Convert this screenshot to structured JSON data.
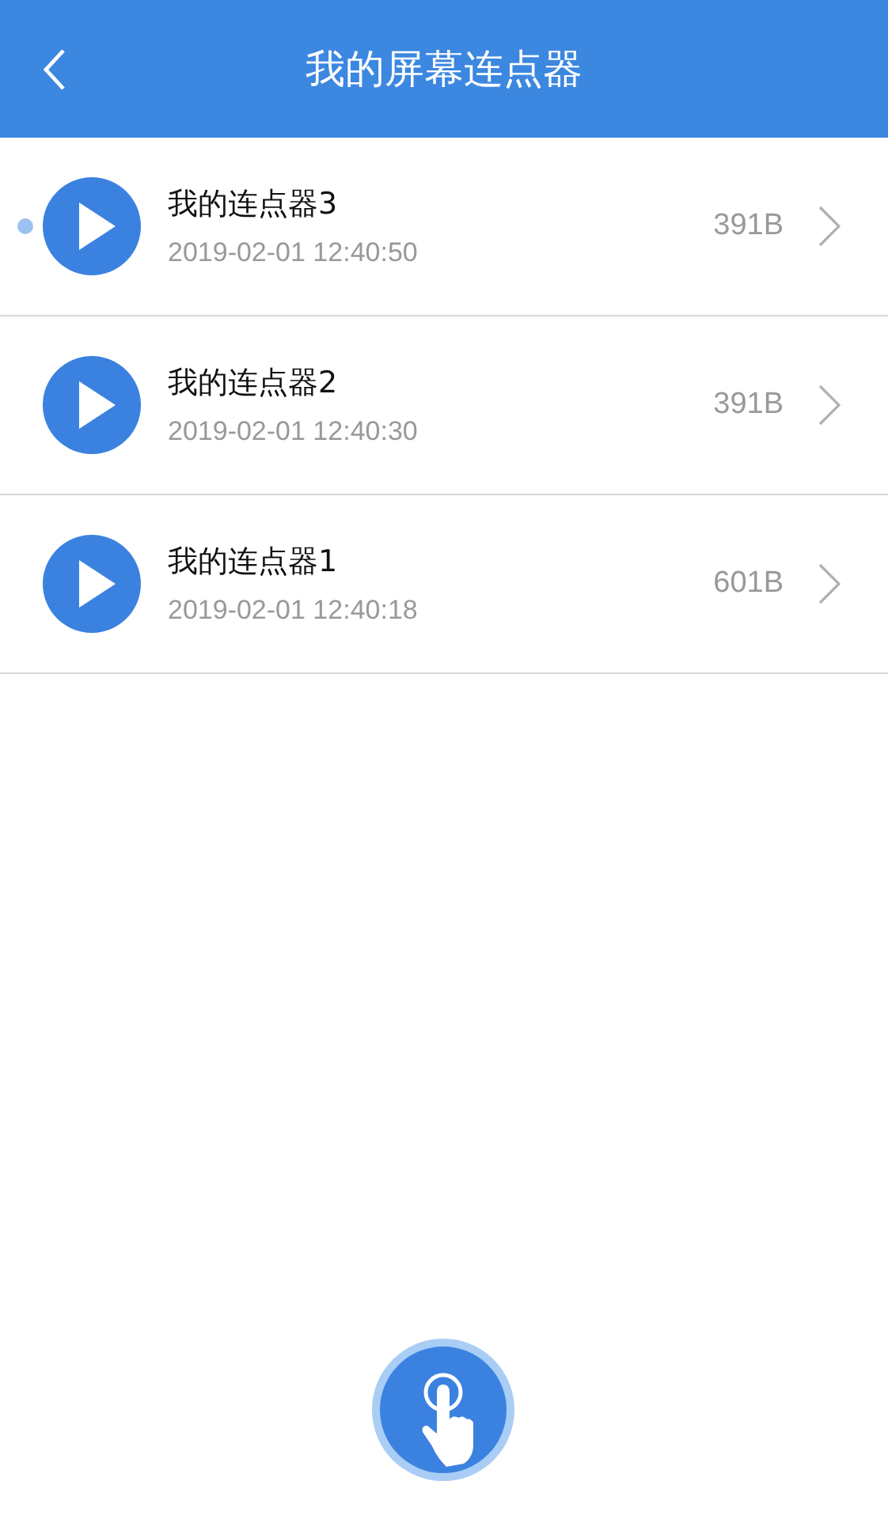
{
  "header": {
    "title": "我的屏幕连点器"
  },
  "items": [
    {
      "name": "我的连点器3",
      "time": "2019-02-01 12:40:50",
      "size": "391B",
      "marked": true
    },
    {
      "name": "我的连点器2",
      "time": "2019-02-01 12:40:30",
      "size": "391B",
      "marked": false
    },
    {
      "name": "我的连点器1",
      "time": "2019-02-01 12:40:18",
      "size": "601B",
      "marked": false
    }
  ]
}
